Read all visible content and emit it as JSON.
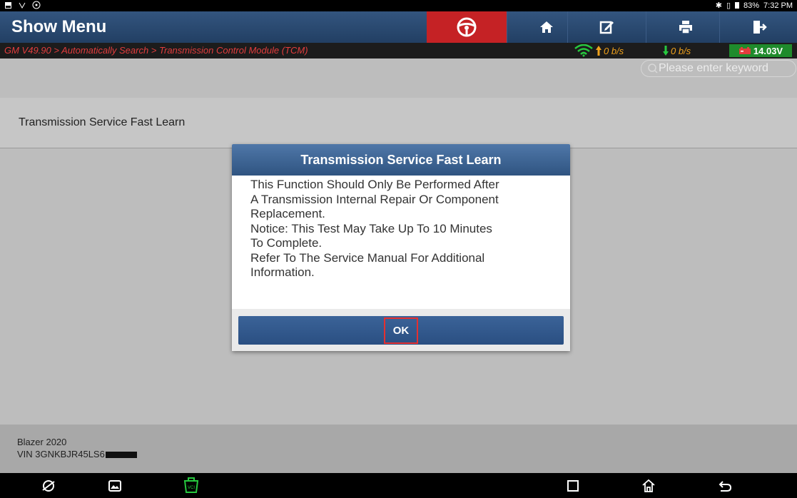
{
  "status_bar": {
    "battery": "83%",
    "time": "7:32 PM"
  },
  "header": {
    "title": "Show Menu",
    "buttons": [
      {
        "name": "steering-wheel-icon"
      },
      {
        "name": "home-icon"
      },
      {
        "name": "edit-icon"
      },
      {
        "name": "print-icon"
      },
      {
        "name": "exit-icon"
      }
    ]
  },
  "breadcrumb": "GM V49.90 > Automatically Search > Transmission Control Module (TCM)",
  "network": {
    "upload": "0 b/s",
    "download": "0 b/s",
    "voltage": "14.03V"
  },
  "search": {
    "placeholder": "Please enter keyword"
  },
  "menu": {
    "items": [
      {
        "label": "Transmission Service Fast Learn"
      }
    ]
  },
  "dialog": {
    "title": "Transmission Service Fast Learn",
    "lines": [
      "This Function Should Only Be Performed After",
      "A Transmission Internal Repair Or Component",
      "Replacement.",
      "Notice: This Test May Take Up To 10 Minutes",
      "To Complete.",
      "Refer To The Service Manual For Additional",
      "Information."
    ],
    "ok_label": "OK"
  },
  "vehicle": {
    "model": "Blazer 2020",
    "vin": "VIN 3GNKBJR45LS6"
  },
  "colors": {
    "header": "#2b4a73",
    "breadcrumb_text": "#e23d3d",
    "voltage_bg": "#1f8b2c",
    "ok_highlight": "#e53030"
  }
}
